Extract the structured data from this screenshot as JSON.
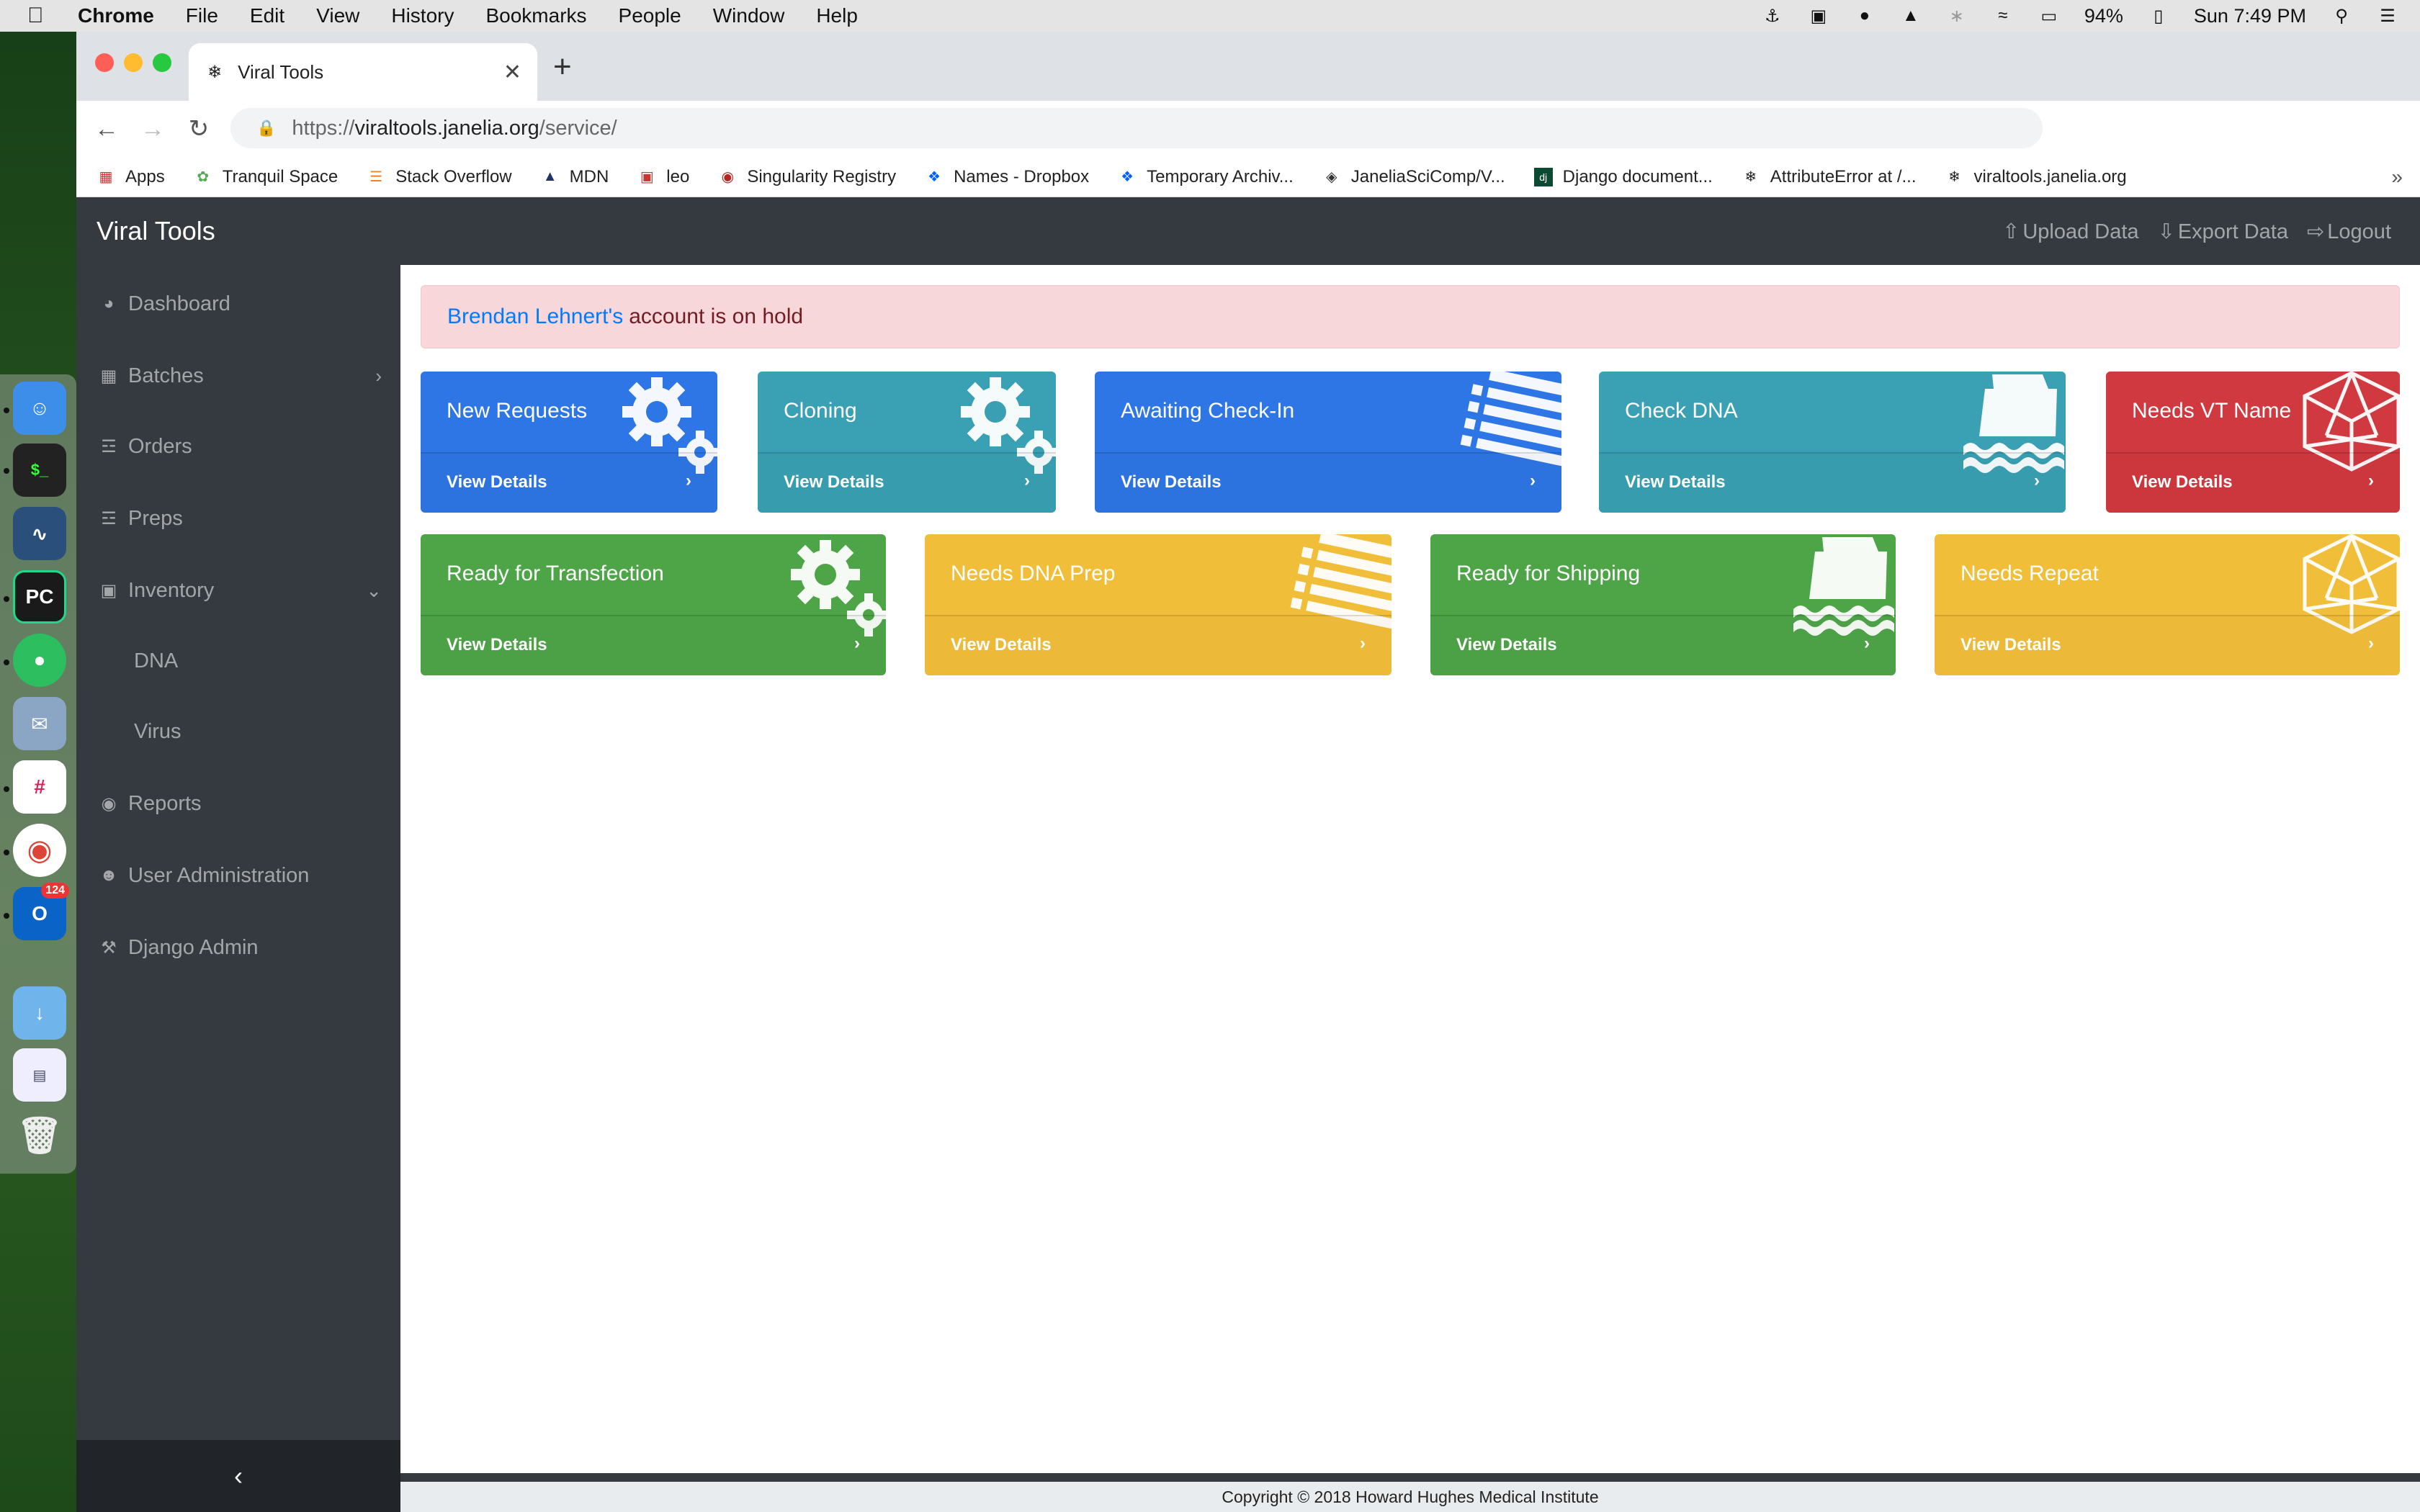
{
  "menubar": {
    "apple": "",
    "items": [
      "Chrome",
      "File",
      "Edit",
      "View",
      "History",
      "Bookmarks",
      "People",
      "Window",
      "Help"
    ],
    "battery": "94%",
    "clock": "Sun 7:49 PM"
  },
  "dock": {
    "outlook_badge": "124"
  },
  "browser": {
    "tab_title": "Viral Tools",
    "url_scheme": "https://",
    "url_host": "viraltools.janelia.org",
    "url_path": "/service/",
    "bookmarks": [
      "Apps",
      "Tranquil Space",
      "Stack Overflow",
      "MDN",
      "leo",
      "Singularity Registry",
      "Names - Dropbox",
      "Temporary Archiv...",
      "JaneliaSciComp/V...",
      "Django document...",
      "AttributeError at /...",
      "viraltools.janelia.org"
    ],
    "bookmarks_more": "»"
  },
  "navbar": {
    "brand": "Viral Tools",
    "upload": "Upload Data",
    "export": "Export Data",
    "logout": "Logout"
  },
  "sidebar": {
    "dashboard": "Dashboard",
    "batches": "Batches",
    "orders": "Orders",
    "preps": "Preps",
    "inventory": "Inventory",
    "dna": "DNA",
    "virus": "Virus",
    "reports": "Reports",
    "user_admin": "User Administration",
    "django_admin": "Django Admin",
    "toggle": "‹"
  },
  "alert": {
    "link": "Brendan Lehnert's",
    "text": "account is on hold"
  },
  "cards": {
    "view_details": "View Details",
    "arrow": "›",
    "new_requests": "New Requests",
    "cloning": "Cloning",
    "awaiting_checkin": "Awaiting Check-In",
    "check_dna": "Check DNA",
    "needs_vt_name": "Needs VT Name",
    "ready_transfection": "Ready for Transfection",
    "needs_dna_prep": "Needs DNA Prep",
    "ready_shipping": "Ready for Shipping",
    "needs_repeat": "Needs Repeat"
  },
  "colors": {
    "primary": "#2e76e5",
    "info": "#3aa0b3",
    "danger": "#d0393f",
    "success": "#4ea548",
    "warning": "#f1be3a",
    "navbar": "#343a40"
  },
  "footer": {
    "text": "Copyright © 2018 Howard Hughes Medical Institute"
  }
}
